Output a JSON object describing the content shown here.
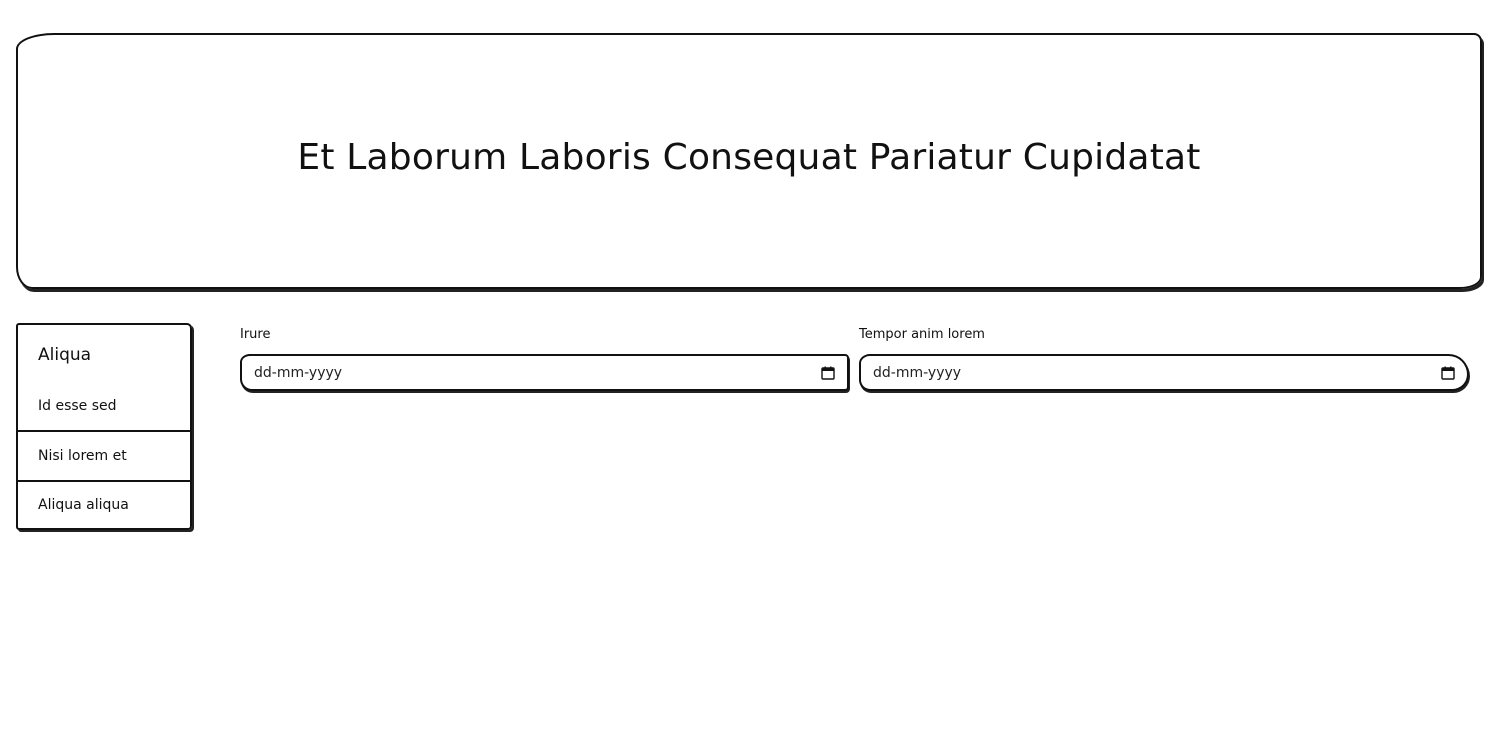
{
  "header": {
    "title": "Et Laborum Laboris Consequat Pariatur Cupidatat"
  },
  "sidebar": {
    "heading": "Aliqua",
    "items": [
      {
        "label": "Id esse sed"
      },
      {
        "label": "Nisi lorem et"
      },
      {
        "label": "Aliqua aliqua"
      }
    ]
  },
  "form": {
    "fields": [
      {
        "label": "Irure",
        "placeholder": "dd-mm-yyyy",
        "icon": "calendar-icon"
      },
      {
        "label": "Tempor anim lorem",
        "placeholder": "dd-mm-yyyy",
        "icon": "calendar-icon"
      }
    ]
  }
}
